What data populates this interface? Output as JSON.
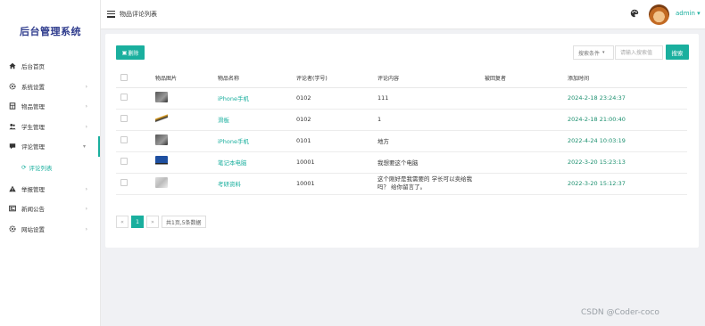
{
  "app": {
    "brand": "后台管理系统"
  },
  "header": {
    "page_title": "物品评论列表",
    "user": "admin",
    "user_caret": "▾"
  },
  "sidebar": {
    "items": [
      {
        "label": "后台首页",
        "icon": "home-icon",
        "has_arrow": false
      },
      {
        "label": "系统设置",
        "icon": "gear-icon",
        "has_arrow": true
      },
      {
        "label": "物品管理",
        "icon": "box-icon",
        "has_arrow": true
      },
      {
        "label": "学生管理",
        "icon": "users-icon",
        "has_arrow": true
      },
      {
        "label": "评论管理",
        "icon": "comment-icon",
        "has_arrow": true,
        "expanded": true
      },
      {
        "label": "举报管理",
        "icon": "warning-icon",
        "has_arrow": true
      },
      {
        "label": "新闻公告",
        "icon": "news-icon",
        "has_arrow": true
      },
      {
        "label": "网站设置",
        "icon": "gear-icon",
        "has_arrow": true
      }
    ],
    "sub_item": {
      "label": "评论列表",
      "icon": "refresh-icon"
    },
    "arrow": "›",
    "arrow_down": "▾"
  },
  "toolbar": {
    "delete_label": "删除",
    "search_condition": "搜索条件",
    "search_placeholder": "请输入搜索值",
    "search_label": "搜索"
  },
  "table": {
    "columns": [
      "物品图片",
      "物品名称",
      "评论者(学号)",
      "评论内容",
      "被回复者",
      "添加时间"
    ],
    "rows": [
      {
        "img": "phone",
        "name": "iPhone手机",
        "author": "0102",
        "content": "111",
        "reply_to": "",
        "time": "2024-2-18 23:24:37"
      },
      {
        "img": "skate",
        "name": "滑板",
        "author": "0102",
        "content": "1",
        "reply_to": "",
        "time": "2024-2-18 21:00:40"
      },
      {
        "img": "phone",
        "name": "iPhone手机",
        "author": "0101",
        "content": "地方",
        "reply_to": "",
        "time": "2022-4-24 10:03:19"
      },
      {
        "img": "laptop",
        "name": "笔记本电脑",
        "author": "10001",
        "content": "我想要这个电脑",
        "reply_to": "",
        "time": "2022-3-20 15:23:13"
      },
      {
        "img": "book",
        "name": "考研资料",
        "author": "10001",
        "content": "这个刚好是我需要的 学长可以卖给我吗？ 给你留言了。",
        "reply_to": "",
        "time": "2022-3-20 15:12:37"
      }
    ]
  },
  "pagination": {
    "prev": "«",
    "current": "1",
    "next": "»",
    "info": "共1页,5条数据"
  },
  "watermark": "CSDN @Coder-coco",
  "colors": {
    "accent": "#1aaf9e",
    "brand": "#2d3a8c"
  }
}
